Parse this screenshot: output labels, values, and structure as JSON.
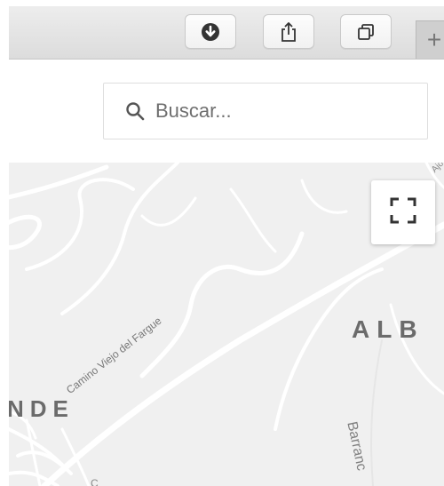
{
  "toolbar": {
    "buttons": [
      {
        "name": "download-button",
        "icon": "download-icon"
      },
      {
        "name": "share-button",
        "icon": "share-icon"
      },
      {
        "name": "tabs-button",
        "icon": "tabs-icon"
      }
    ],
    "new_tab_icon": "plus-icon",
    "new_tab_symbol": "+"
  },
  "search": {
    "icon": "search-icon",
    "placeholder": "Buscar..."
  },
  "map": {
    "fullscreen_icon": "fullscreen-icon",
    "labels": {
      "district_left": "NDE",
      "district_right": "ALB",
      "road": "Camino Viejo del Fargue",
      "barranco": "Barranc",
      "corner": "Ajo",
      "bottom": "C"
    },
    "colors": {
      "land": "#f0f0f0",
      "road": "#ffffff"
    }
  }
}
